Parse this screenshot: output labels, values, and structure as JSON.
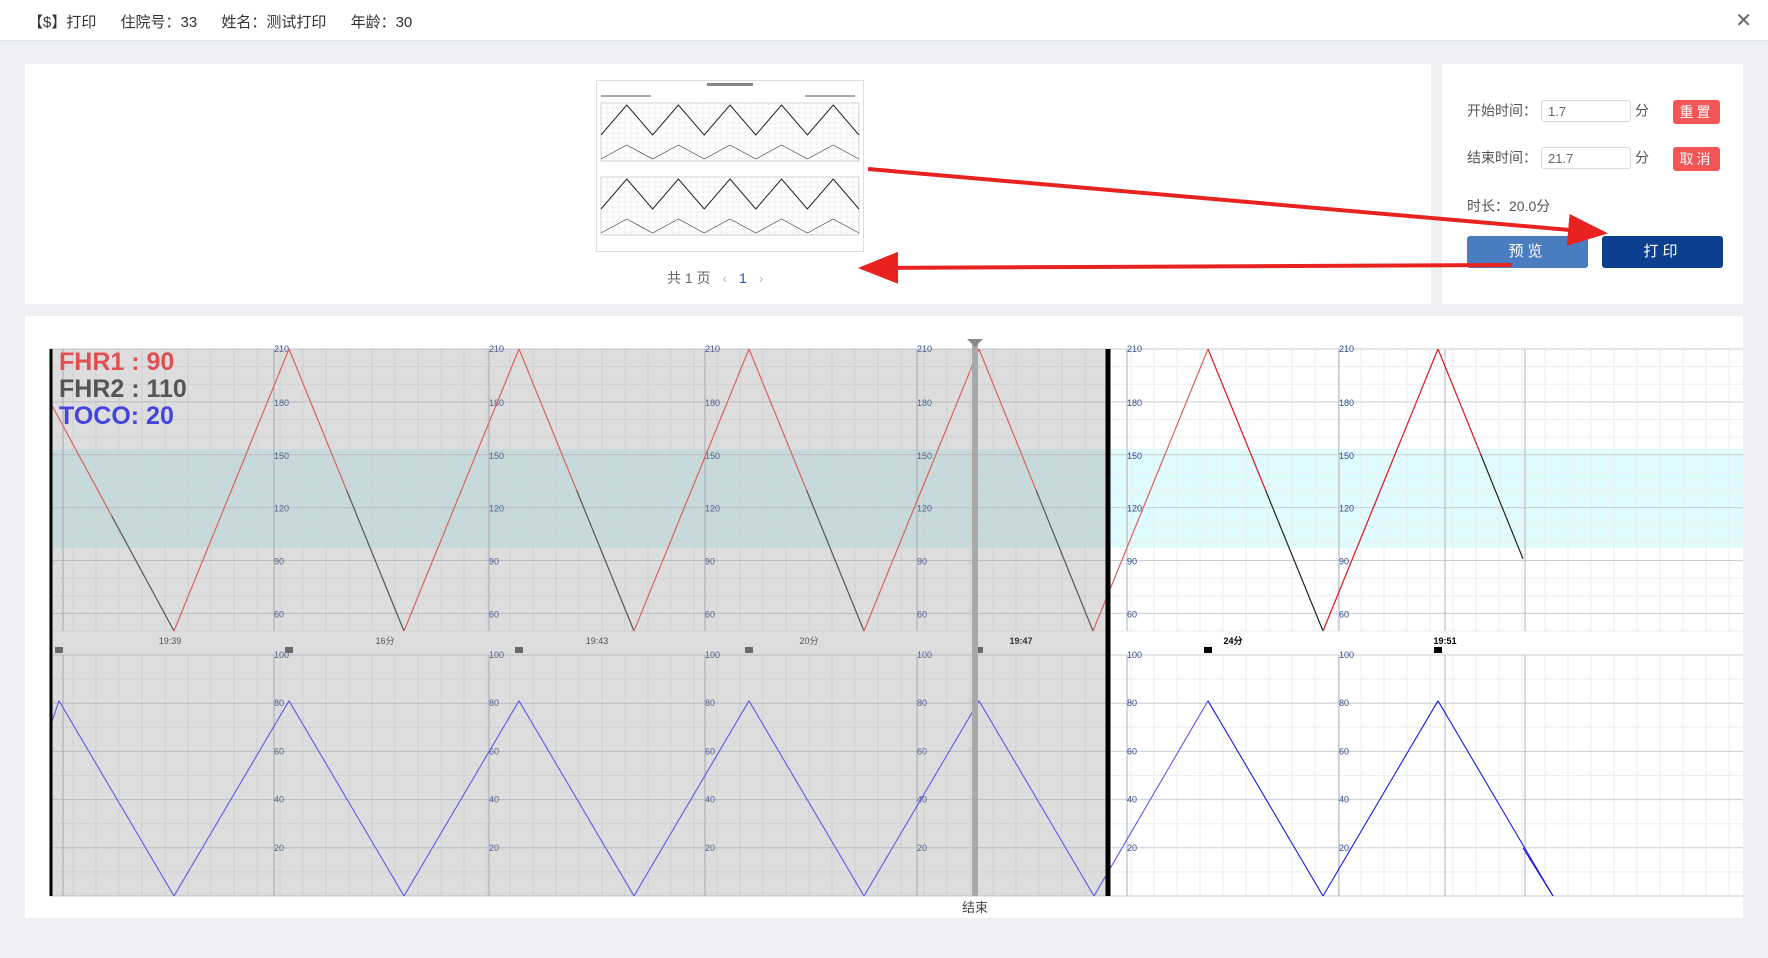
{
  "header": {
    "prefix": "【$】打印",
    "admission": "住院号：33",
    "name": "姓名：测试打印",
    "age": "年龄：30"
  },
  "pager": {
    "total": "共 1 页",
    "current": "1",
    "prev_icon": "chevron-left-icon",
    "next_icon": "chevron-right-icon"
  },
  "controls": {
    "start_label": "开始时间：",
    "start_value": "1.7",
    "start_unit": "分",
    "end_label": "结束时间：",
    "end_value": "21.7",
    "end_unit": "分",
    "duration": "时长：20.0分",
    "reset_label": "重置",
    "cancel_label": "取消",
    "preview_label": "预览",
    "print_label": "打印"
  },
  "legend": {
    "fhr1": "FHR1 : 90",
    "fhr2": "FHR2 : 110",
    "toco": "TOCO: 20"
  },
  "end_marker": "结束",
  "chart_data": {
    "type": "line",
    "fhr_axis": {
      "ticks": [
        210,
        180,
        150,
        120,
        90,
        60
      ],
      "range": [
        50,
        210
      ],
      "normal_band": [
        110,
        160
      ]
    },
    "toco_axis": {
      "ticks": [
        100,
        80,
        60,
        40,
        20
      ],
      "range": [
        0,
        100
      ]
    },
    "time_labels": [
      "19:39",
      "16分",
      "19:43",
      "20分",
      "19:47",
      "24分",
      "19:51"
    ],
    "fhr_series": {
      "name": "FHR1",
      "pattern": "triangle",
      "min": 50,
      "max": 210
    },
    "toco_series": {
      "name": "TOCO",
      "pattern": "triangle",
      "min": 0,
      "max": 81
    },
    "selection_range_min": [
      1.7,
      21.7
    ]
  },
  "colors": {
    "fhr1": "#e05050",
    "fhr2": "#555555",
    "toco": "#4444e0",
    "primary": "#3b6db3",
    "print": "#0d3f8f",
    "danger": "#f25555",
    "arrow": "#e8221e"
  }
}
